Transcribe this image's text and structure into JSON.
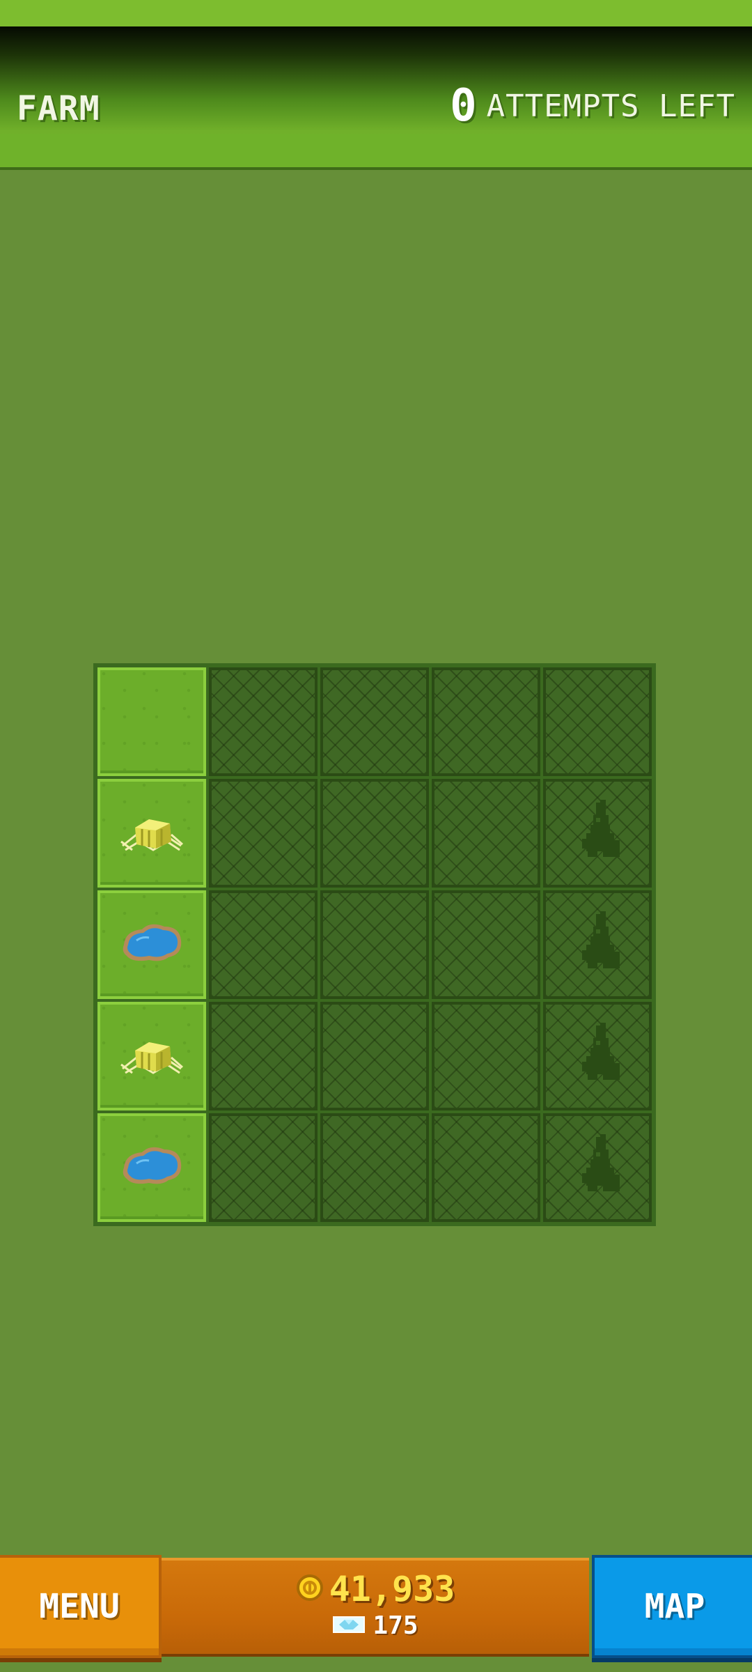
{
  "header": {
    "title": "FARM",
    "attempts_count": "0",
    "attempts_label": "ATTEMPTS LEFT"
  },
  "board": {
    "rows": [
      [
        "grass",
        "covered",
        "covered",
        "covered",
        "covered"
      ],
      [
        "hay-bale-icon",
        "covered",
        "covered",
        "covered",
        "rabbit-silhouette-icon"
      ],
      [
        "pond-icon",
        "covered",
        "covered",
        "covered",
        "rabbit-silhouette-icon"
      ],
      [
        "hay-bale-icon",
        "covered",
        "covered",
        "covered",
        "rabbit-silhouette-icon"
      ],
      [
        "pond-icon",
        "covered",
        "covered",
        "covered",
        "rabbit-silhouette-icon"
      ]
    ]
  },
  "footer": {
    "menu_label": "MENU",
    "coins": "41,933",
    "gems": "175",
    "map_label": "MAP"
  },
  "colors": {
    "background": "#668f38",
    "grass": "#6cae2a",
    "covered": "#3f6824",
    "menu": "#e8900a",
    "map": "#0a9ae8",
    "coins": "#ffe34d"
  }
}
